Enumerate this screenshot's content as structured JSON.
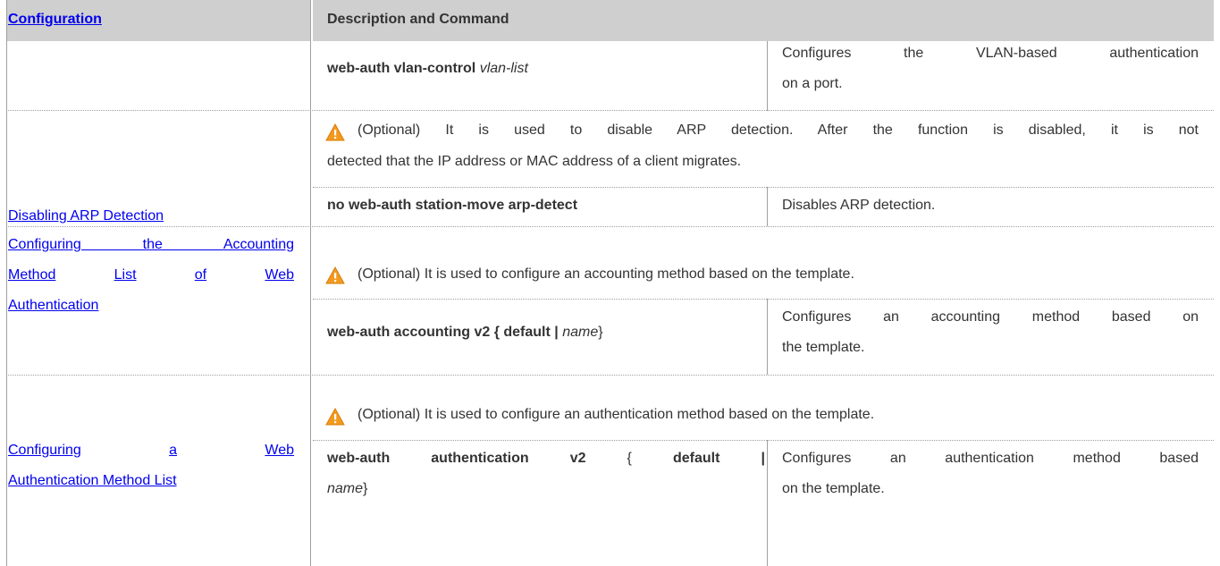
{
  "header": {
    "col1": "Configuration",
    "col2": "Description and Command"
  },
  "rows": {
    "vlan": {
      "cmd_bold": "web-auth vlan-control",
      "cmd_ital": "vlan-list",
      "desc_line1": "Configures the VLAN-based authentication",
      "desc_line2": "on a port."
    },
    "arp": {
      "config": "Disabling ARP Detection",
      "note_line1": "(Optional) It is used to disable ARP detection. After the function is disabled, it is not",
      "note_line2": "detected that the IP address or MAC address of a client migrates.",
      "cmd": "no web-auth station-move arp-detect",
      "desc": "Disables ARP detection."
    },
    "acct": {
      "config_line1": "Configuring the Accounting",
      "config_line2_a": "Method",
      "config_line2_b": "List",
      "config_line2_c": "of",
      "config_line2_d": "Web",
      "config_line3": "Authentication",
      "note": "(Optional) It is used to configure an accounting method based on the template.",
      "cmd_bold": "web-auth accounting v2 { default |",
      "cmd_ital": "name",
      "cmd_end": "}",
      "desc_line1": "Configures an accounting method based on",
      "desc_line2": "the template."
    },
    "authn": {
      "config_line1_a": "Configuring",
      "config_line1_b": "a",
      "config_line1_c": "Web",
      "config_line2": "Authentication Method List",
      "note": "(Optional) It is used to configure an authentication method based on the template.",
      "cmd_line1_a": "web-auth",
      "cmd_line1_b": "authentication",
      "cmd_line1_c": "v2",
      "cmd_line1_d": "{",
      "cmd_line1_e": "default",
      "cmd_line1_f": "|",
      "cmd_line2_ital": "name",
      "cmd_line2_end": "}",
      "desc_line1": "Configures an authentication method based",
      "desc_line2": "on the template."
    }
  },
  "colors": {
    "header_bg": "#cfcfcf",
    "link": "#0000ee",
    "warning_orange": "#f39a1e"
  },
  "icons": {
    "warning": "warning-icon"
  }
}
